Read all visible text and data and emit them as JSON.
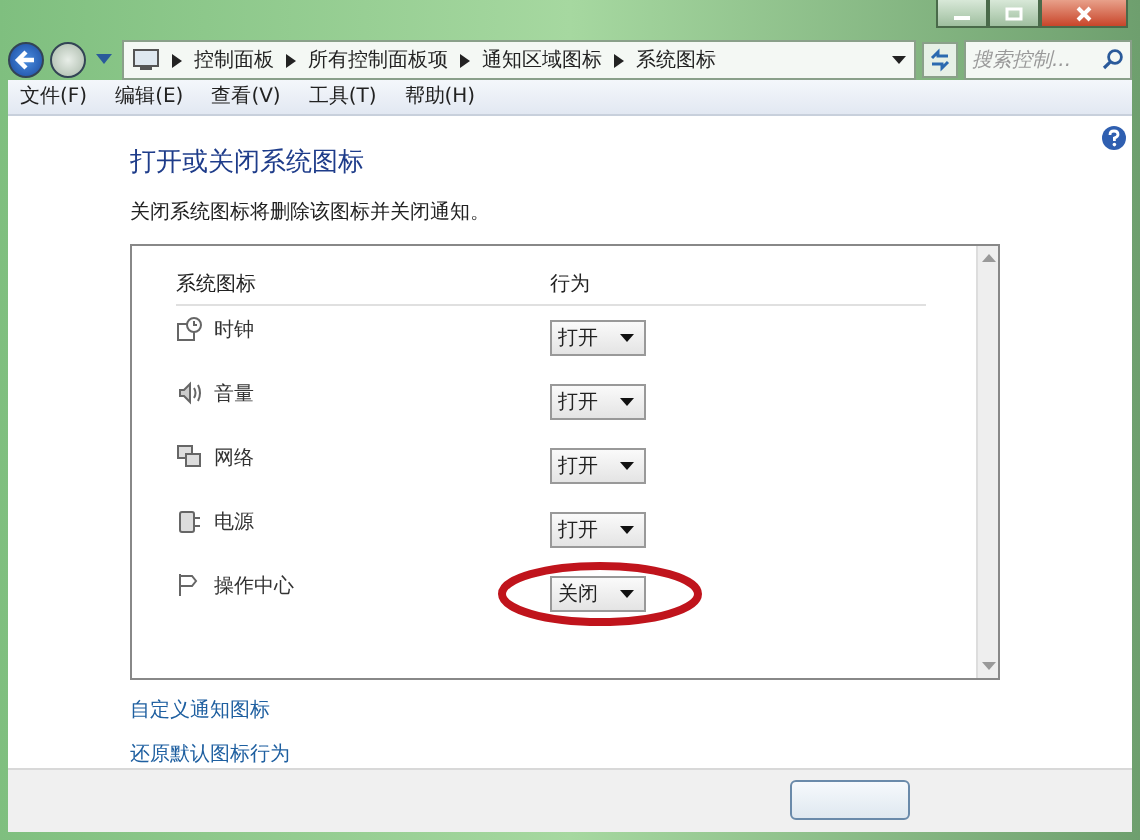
{
  "address_bar": {
    "breadcrumbs": [
      "控制面板",
      "所有控制面板项",
      "通知区域图标",
      "系统图标"
    ],
    "search_placeholder": "搜索控制..."
  },
  "menu": [
    "文件(F)",
    "编辑(E)",
    "查看(V)",
    "工具(T)",
    "帮助(H)"
  ],
  "heading": "打开或关闭系统图标",
  "description": "关闭系统图标将删除该图标并关闭通知。",
  "table": {
    "columns": [
      "系统图标",
      "行为"
    ],
    "rows": [
      {
        "kind": "clock",
        "name": "时钟",
        "behavior": "打开",
        "highlighted": false
      },
      {
        "kind": "volume",
        "name": "音量",
        "behavior": "打开",
        "highlighted": false
      },
      {
        "kind": "network",
        "name": "网络",
        "behavior": "打开",
        "highlighted": false
      },
      {
        "kind": "power",
        "name": "电源",
        "behavior": "打开",
        "highlighted": false
      },
      {
        "kind": "flag",
        "name": "操作中心",
        "behavior": "关闭",
        "highlighted": true
      }
    ]
  },
  "links": [
    "自定义通知图标",
    "还原默认图标行为"
  ]
}
